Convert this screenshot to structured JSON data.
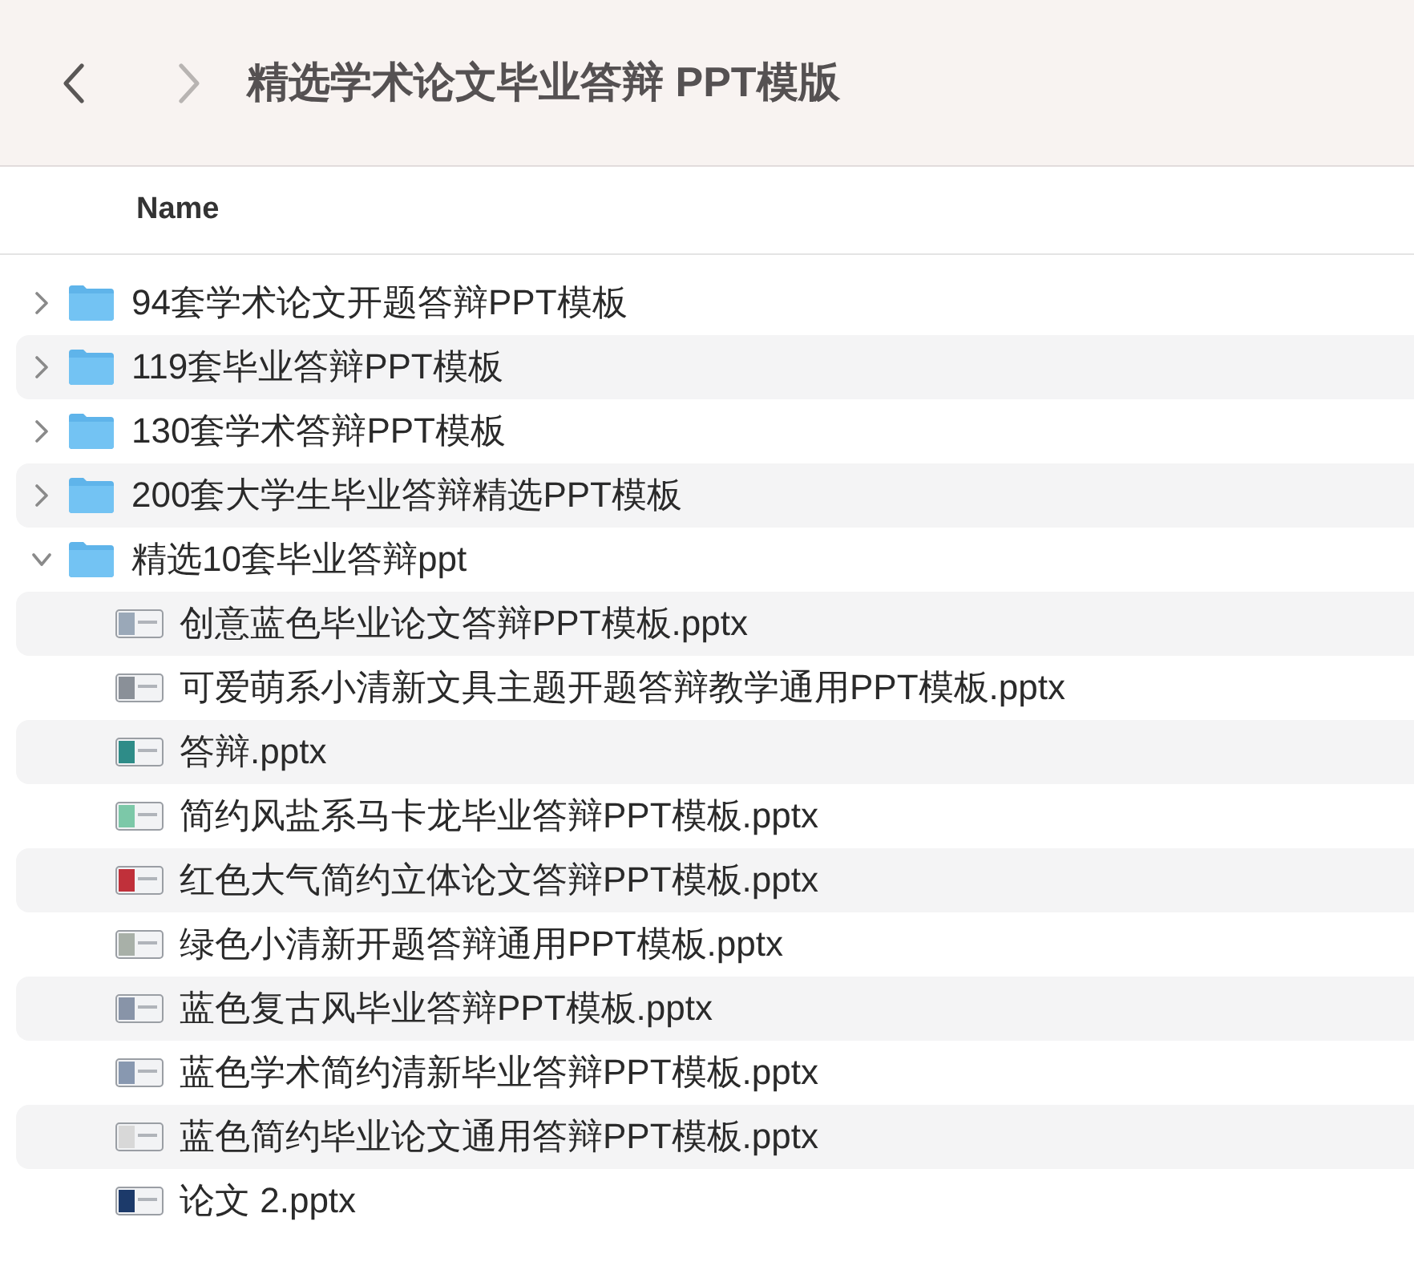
{
  "toolbar": {
    "back_disabled": false,
    "forward_disabled": true,
    "title": "精选学术论文毕业答辩 PPT模版"
  },
  "columns": [
    {
      "label": "Name"
    }
  ],
  "items": [
    {
      "kind": "folder",
      "name": "94套学术论文开题答辩PPT模板",
      "expanded": false
    },
    {
      "kind": "folder",
      "name": "119套毕业答辩PPT模板",
      "expanded": false
    },
    {
      "kind": "folder",
      "name": "130套学术答辩PPT模板",
      "expanded": false
    },
    {
      "kind": "folder",
      "name": "200套大学生毕业答辩精选PPT模板",
      "expanded": false
    },
    {
      "kind": "folder",
      "name": "精选10套毕业答辩ppt",
      "expanded": true,
      "children": [
        {
          "kind": "file",
          "name": "创意蓝色毕业论文答辩PPT模板.pptx",
          "color": "#9aa8b8"
        },
        {
          "kind": "file",
          "name": "可爱萌系小清新文具主题开题答辩教学通用PPT模板.pptx",
          "color": "#8a9098"
        },
        {
          "kind": "file",
          "name": "答辩.pptx",
          "color": "#2e8c88"
        },
        {
          "kind": "file",
          "name": "简约风盐系马卡龙毕业答辩PPT模板.pptx",
          "color": "#7cc8a8"
        },
        {
          "kind": "file",
          "name": "红色大气简约立体论文答辩PPT模板.pptx",
          "color": "#c0303a"
        },
        {
          "kind": "file",
          "name": "绿色小清新开题答辩通用PPT模板.pptx",
          "color": "#a8b0a8"
        },
        {
          "kind": "file",
          "name": "蓝色复古风毕业答辩PPT模板.pptx",
          "color": "#8894a8"
        },
        {
          "kind": "file",
          "name": "蓝色学术简约清新毕业答辩PPT模板.pptx",
          "color": "#8898b0"
        },
        {
          "kind": "file",
          "name": "蓝色简约毕业论文通用答辩PPT模板.pptx",
          "color": "#d8d8d8"
        },
        {
          "kind": "file",
          "name": "论文 2.pptx",
          "color": "#1c3a6a"
        }
      ]
    }
  ]
}
